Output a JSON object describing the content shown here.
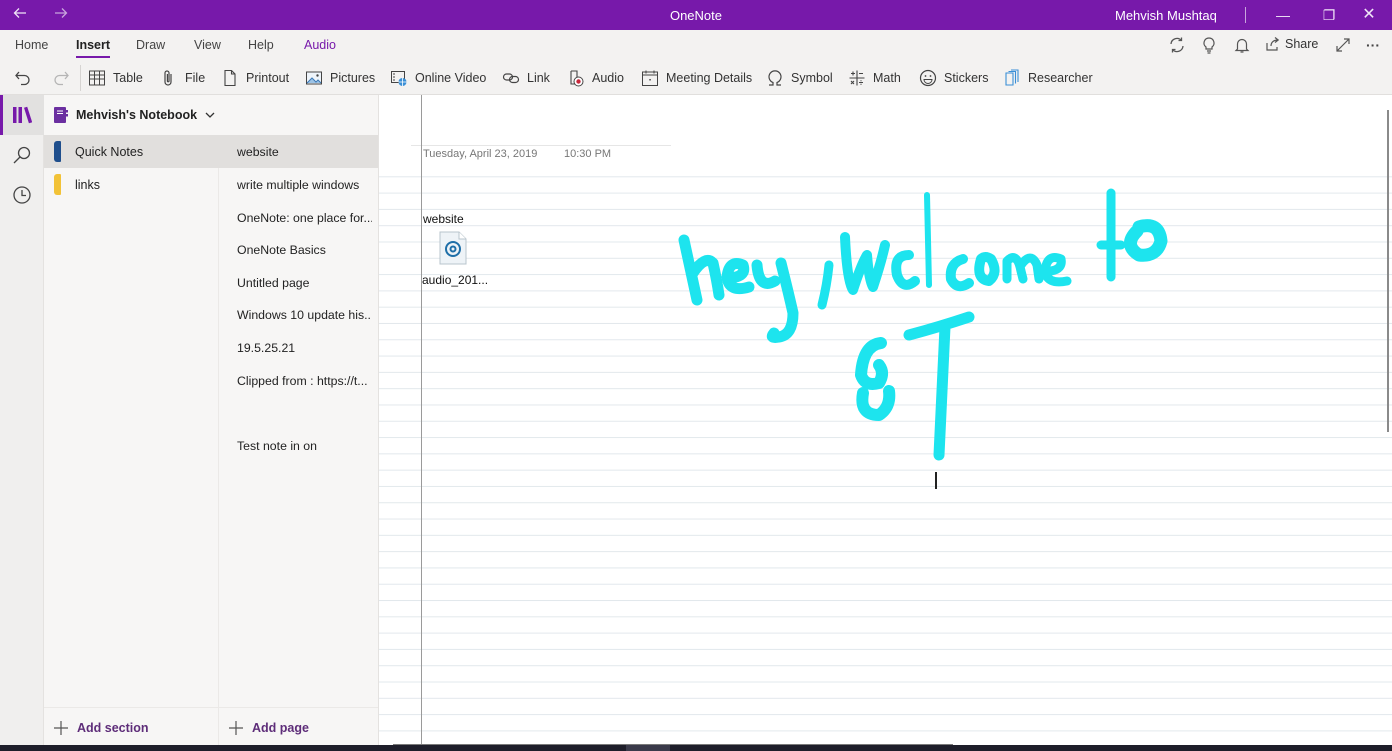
{
  "app": {
    "title": "OneNote",
    "user": "Mehvish Mushtaq",
    "accent": "#7719aa"
  },
  "titlebar": {
    "back_icon": "arrow-left-icon",
    "forward_icon": "arrow-right-icon",
    "minimize_glyph": "—",
    "maximize_glyph": "❐",
    "close_glyph": "✕"
  },
  "ribbon": {
    "tabs": [
      {
        "label": "Home"
      },
      {
        "label": "Insert",
        "active": true
      },
      {
        "label": "Draw"
      },
      {
        "label": "View"
      },
      {
        "label": "Help"
      },
      {
        "label": "Audio"
      }
    ],
    "share_label": "Share",
    "more_glyph": "···",
    "toolbar": [
      {
        "label": "Table",
        "icon": "table-icon"
      },
      {
        "label": "File",
        "icon": "paperclip-icon"
      },
      {
        "label": "Printout",
        "icon": "document-icon"
      },
      {
        "label": "Pictures",
        "icon": "picture-icon"
      },
      {
        "label": "Online Video",
        "icon": "online-video-icon"
      },
      {
        "label": "Link",
        "icon": "link-icon"
      },
      {
        "label": "Audio",
        "icon": "audio-record-icon"
      },
      {
        "label": "Meeting Details",
        "icon": "calendar-icon"
      },
      {
        "label": "Symbol",
        "icon": "omega-icon"
      },
      {
        "label": "Math",
        "icon": "math-icon"
      },
      {
        "label": "Stickers",
        "icon": "smiley-icon"
      },
      {
        "label": "Researcher",
        "icon": "researcher-icon"
      }
    ]
  },
  "notebook": {
    "name": "Mehvish's Notebook",
    "color": "#6b2fa0",
    "sections": [
      {
        "label": "Quick Notes",
        "color": "#1f4e8c",
        "active": true
      },
      {
        "label": "links",
        "color": "#f2c237"
      }
    ],
    "add_section_label": "Add section"
  },
  "pages": {
    "items": [
      {
        "label": "website",
        "active": true
      },
      {
        "label": "write multiple windows"
      },
      {
        "label": "OneNote: one place for..."
      },
      {
        "label": "OneNote Basics"
      },
      {
        "label": "Untitled page"
      },
      {
        "label": "Windows 10 update his..."
      },
      {
        "label": "19.5.25.21"
      },
      {
        "label": "Clipped from : https://t..."
      },
      {
        "label": ""
      },
      {
        "label": "Test note in on"
      }
    ],
    "add_page_label": "Add page"
  },
  "page": {
    "date": "Tuesday, April 23, 2019",
    "time": "10:30 PM",
    "note_title": "website",
    "attachment_label": "audio_201...",
    "ink_text": "hey, welcome to GT",
    "ink_color": "#1de4ee"
  }
}
